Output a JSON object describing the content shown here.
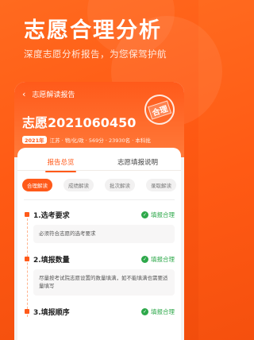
{
  "hero": {
    "headline": "志愿合理分析",
    "subline": "深度志愿分析报告，为您保驾护航"
  },
  "report": {
    "nav_title": "志愿解读报告",
    "name": "志愿2021060450",
    "year": "2021年",
    "meta": "江苏 · 物/化/政 · 569分 · 23930名 · 本科批",
    "stamp": "合理"
  },
  "tabs": [
    "报告总览",
    "志愿填报说明"
  ],
  "chips": [
    "合理解读",
    "成绩解读",
    "批次解读",
    "录取解读"
  ],
  "sections": [
    {
      "title": "1.选考要求",
      "status": "填报合理",
      "body": "必须符合志愿的选考要求"
    },
    {
      "title": "2.填报数量",
      "status": "填报合理",
      "body": "尽量按考试院志愿设置的数量填满，如不能填满也需要适量填写"
    },
    {
      "title": "3.填报顺序",
      "status": "填报合理",
      "body": ""
    }
  ],
  "colors": {
    "accent": "#ff5a1a",
    "ok": "#2da84a"
  }
}
